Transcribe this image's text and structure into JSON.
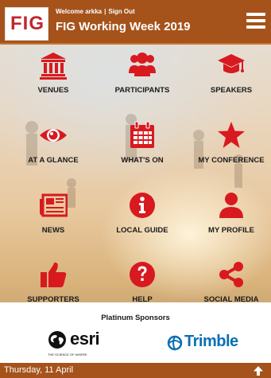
{
  "header": {
    "logo_text": "FIG",
    "welcome_text": "Welcome arkka",
    "separator": "|",
    "sign_out": "Sign Out",
    "title": "FIG Working Week 2019"
  },
  "menu": {
    "items": [
      {
        "label": "VENUES",
        "icon": "building-icon"
      },
      {
        "label": "PARTICIPANTS",
        "icon": "users-icon"
      },
      {
        "label": "SPEAKERS",
        "icon": "graduation-cap-icon"
      },
      {
        "label": "AT A GLANCE",
        "icon": "eye-icon"
      },
      {
        "label": "WHAT'S ON",
        "icon": "calendar-icon"
      },
      {
        "label": "MY CONFERENCE",
        "icon": "star-icon"
      },
      {
        "label": "NEWS",
        "icon": "newspaper-icon"
      },
      {
        "label": "LOCAL GUIDE",
        "icon": "info-icon"
      },
      {
        "label": "MY PROFILE",
        "icon": "user-icon"
      },
      {
        "label": "SUPPORTERS",
        "icon": "thumbs-up-icon"
      },
      {
        "label": "HELP",
        "icon": "question-icon"
      },
      {
        "label": "SOCIAL MEDIA",
        "icon": "share-icon"
      }
    ]
  },
  "sponsors": {
    "title": "Platinum Sponsors",
    "esri": "esri",
    "esri_tagline": "THE SCIENCE OF WHERE",
    "trimble": "Trimble"
  },
  "footer": {
    "date": "Thursday, 11 April"
  },
  "colors": {
    "header_bg": "#a5531b",
    "icon_red": "#d8191f",
    "trimble_blue": "#0a6fb5"
  }
}
